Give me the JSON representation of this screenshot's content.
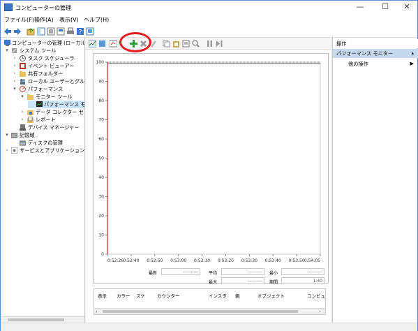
{
  "window": {
    "title": "コンピューターの管理"
  },
  "menu": [
    "ファイル(F)",
    "操作(A)",
    "表示(V)",
    "ヘルプ(H)"
  ],
  "tree": {
    "items": [
      {
        "label": "コンピューターの管理 (ローカル)",
        "level": 0,
        "arrow": ""
      },
      {
        "label": "システム ツール",
        "level": 1,
        "arrow": "▾"
      },
      {
        "label": "タスク スケジューラ",
        "level": 2,
        "arrow": "›"
      },
      {
        "label": "イベント ビューアー",
        "level": 2,
        "arrow": "›"
      },
      {
        "label": "共有フォルダー",
        "level": 2,
        "arrow": "›"
      },
      {
        "label": "ローカル ユーザーとグループ",
        "level": 2,
        "arrow": "›"
      },
      {
        "label": "パフォーマンス",
        "level": 2,
        "arrow": "▾"
      },
      {
        "label": "モニター ツール",
        "level": 3,
        "arrow": "▾"
      },
      {
        "label": "パフォーマンス モニター",
        "level": 4,
        "arrow": ""
      },
      {
        "label": "データ コレクター セット",
        "level": 3,
        "arrow": "›"
      },
      {
        "label": "レポート",
        "level": 3,
        "arrow": "›"
      },
      {
        "label": "デバイス マネージャー",
        "level": 2,
        "arrow": ""
      },
      {
        "label": "記憶域",
        "level": 1,
        "arrow": "▾"
      },
      {
        "label": "ディスクの管理",
        "level": 2,
        "arrow": ""
      },
      {
        "label": "サービスとアプリケーション",
        "level": 1,
        "arrow": "›"
      }
    ]
  },
  "chart_data": {
    "type": "line",
    "y_ticks": [
      "100",
      "90",
      "80",
      "70",
      "60",
      "50",
      "40",
      "30",
      "20",
      "10",
      "0"
    ],
    "ylim": [
      0,
      100
    ],
    "x_ticks": [
      "0:52:26",
      "0:52:40",
      "0:52:50",
      "0:53:00",
      "0:53:10",
      "0:53:20",
      "0:53:30",
      "0:53:40",
      "0:53:50",
      "0:54:05"
    ],
    "series": [],
    "grid": false
  },
  "stats": {
    "last_label": "最新",
    "last_value": "----------",
    "avg_label": "平均",
    "avg_value": "----------",
    "min_label": "最小",
    "min_value": "----------",
    "max_label": "最大",
    "max_value": "----------",
    "duration_label": "期間",
    "duration_value": "1:40"
  },
  "counter_table": {
    "columns": [
      "表示",
      "カラー",
      "スケ",
      "カウンター",
      "インスタ",
      "親",
      "オブジェクト",
      "コンピュ"
    ]
  },
  "actions": {
    "header": "操作",
    "section": "パフォーマンス モニター",
    "other": "他の操作"
  },
  "colors": {
    "accent": "#3b78c8",
    "plot_line": "#e41b1b",
    "highlight": "#e41b1b"
  }
}
